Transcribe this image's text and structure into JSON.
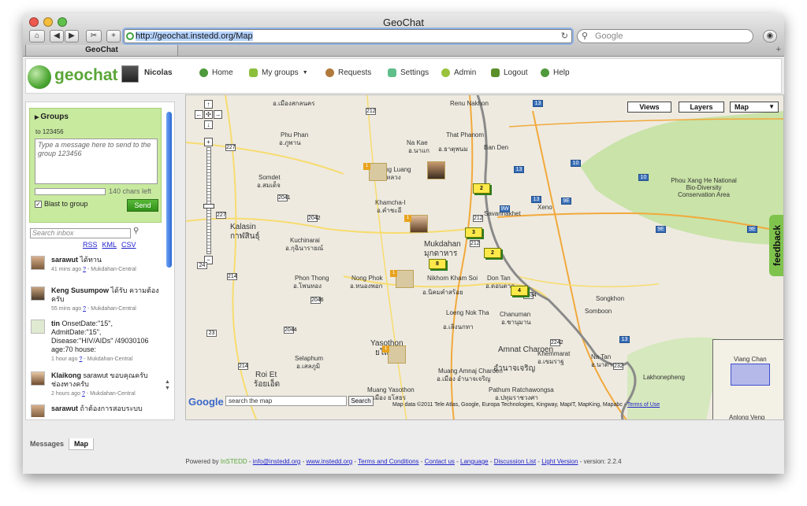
{
  "browser": {
    "window_title": "GeoChat",
    "url": "http://geochat.instedd.org/Map",
    "search_placeholder": "Google",
    "tab_title": "GeoChat"
  },
  "header": {
    "logo_text": "geochat",
    "user_name": "Nicolas",
    "nav": [
      {
        "label": "Home",
        "icon": "home-icon"
      },
      {
        "label": "My groups",
        "icon": "folder-icon"
      },
      {
        "label": "Requests",
        "icon": "person-icon"
      },
      {
        "label": "Settings",
        "icon": "settings-icon"
      },
      {
        "label": "Admin",
        "icon": "gear-icon"
      },
      {
        "label": "Logout",
        "icon": "logout-icon"
      },
      {
        "label": "Help",
        "icon": "help-icon"
      }
    ]
  },
  "sidebar": {
    "groups_title": "Groups",
    "to_line": "to 123456",
    "message_placeholder": "Type a message here to send to the group 123456",
    "chars_left": "140 chars left",
    "blast_label": "Blast to group",
    "send_label": "Send",
    "inbox_placeholder": "Search inbox",
    "feeds": [
      "RSS",
      "KML",
      "CSV"
    ],
    "messages": [
      {
        "author": "sarawut",
        "body": "ได้ทาน",
        "time": "41 mins ago",
        "q": "?",
        "group": "Mukdahan-Central"
      },
      {
        "author": "Keng Susumpow",
        "body": "ได้รับ ความต้องครับ",
        "time": "55 mins ago",
        "q": "?",
        "group": "Mukdahan-Central"
      },
      {
        "author": "tin",
        "body": "OnsetDate:\"15\", AdmitDate:\"15\", Disease:\"HIV/AIDs\" /49030106 age:70 house:",
        "time": "1 hour ago",
        "q": "?",
        "group": "Mukdahan-Central"
      },
      {
        "author": "Klaikong",
        "body": "sarawut ขอบคุณครับ ช่องทางครับ",
        "time": "2 hours ago",
        "q": "?",
        "group": "Mukdahan-Central"
      },
      {
        "author": "sarawut",
        "body": "ถ้าต้องการสอบระบบ",
        "time": "",
        "q": "",
        "group": ""
      }
    ]
  },
  "map": {
    "buttons": [
      "Views",
      "Layers",
      "Map"
    ],
    "labels": [
      "อ.เมืองสกลนคร",
      "Renu Nakhon",
      "Phu Phan",
      "อ.ภูพาน",
      "That Phanom",
      "อ.ธาตุพนม",
      "Na Kae",
      "อ.นาแก",
      "Ban Den",
      "Somdet",
      "อ.สมเด็จ",
      "Khong Luang",
      "อ.ดงหลวง",
      "Kalasin",
      "กาฬสินธุ์",
      "Kuchinarai",
      "อ.กุฉินารายณ์",
      "Khamcha-I",
      "อ.คำชะอี",
      "Mukdahan",
      "มุกดาหาร",
      "Savannakhet",
      "Xeno",
      "Phou Xang He National Bio-Diversity Conservation Area",
      "Phon Thong",
      "อ.โพนทอง",
      "Nong Phok",
      "อ.หนองพอก",
      "Nikhom Kham Soi",
      "อ.นิคมคำสร้อย",
      "Don Tan",
      "อ.ดอนตาล",
      "Songkhon",
      "Somboon",
      "Loeng Nok Tha",
      "อ.เลิงนกทา",
      "Chanuman",
      "อ.ชานุมาน",
      "Selaphum",
      "อ.เสลภูมิ",
      "Yasothon",
      "ยโสธร",
      "Amnat Charoen",
      "อำนาจเจริญ",
      "Khemmarat",
      "อ.เขมราฐ",
      "Na Tan",
      "อ.นาตาล",
      "Lakhonepheng",
      "Muang Amnaj Charoen",
      "อ.เมือง อำนาจเจริญ",
      "Pathum Ratchawongsa",
      "อ.ปทุมราชวงศา",
      "Roi Et",
      "ร้อยเอ็ด",
      "Muang Yasothon",
      "อ.เมือง ยโสธร"
    ],
    "route_numbers": [
      "13",
      "13",
      "13",
      "10",
      "10",
      "9E",
      "9E",
      "9E",
      "9W",
      "227",
      "2041",
      "2042",
      "227",
      "212",
      "212",
      "212",
      "214",
      "2046",
      "2044",
      "214",
      "23",
      "232",
      "2034",
      "2242",
      "13",
      "24"
    ],
    "markers": [
      "2",
      "3",
      "8",
      "2",
      "4"
    ],
    "overview_labels": [
      "Viang Chan",
      "Anlong Veng"
    ],
    "search_placeholder": "search the map",
    "search_button": "Search",
    "google_logo": "Google",
    "attribution": "Map data ©2011 Tele Atlas, Google, Europa Technologies, Kingway, MapIT, MapKing, Mapabc -",
    "terms": "Terms of Use",
    "feedback": "feedback"
  },
  "bottom_tabs": [
    "Messages",
    "Map"
  ],
  "footer": {
    "prefix": "Powered by",
    "brand": "InSTEDD",
    "links": [
      "info@instedd.org",
      "www.instedd.org",
      "Terms and Conditions",
      "Contact us",
      "Language",
      "Discussion List",
      "Light Version"
    ],
    "version": "- version: 2.2.4"
  },
  "colors": {
    "accent_green": "#5aa637",
    "groups_panel": "#c8ea9f",
    "marker_yellow": "#ffe94a",
    "border_river": "#8a8a8a",
    "road_orange": "#f2a93b",
    "road_yellow": "#f7dc6f",
    "forest_green": "#c9e3a8"
  }
}
